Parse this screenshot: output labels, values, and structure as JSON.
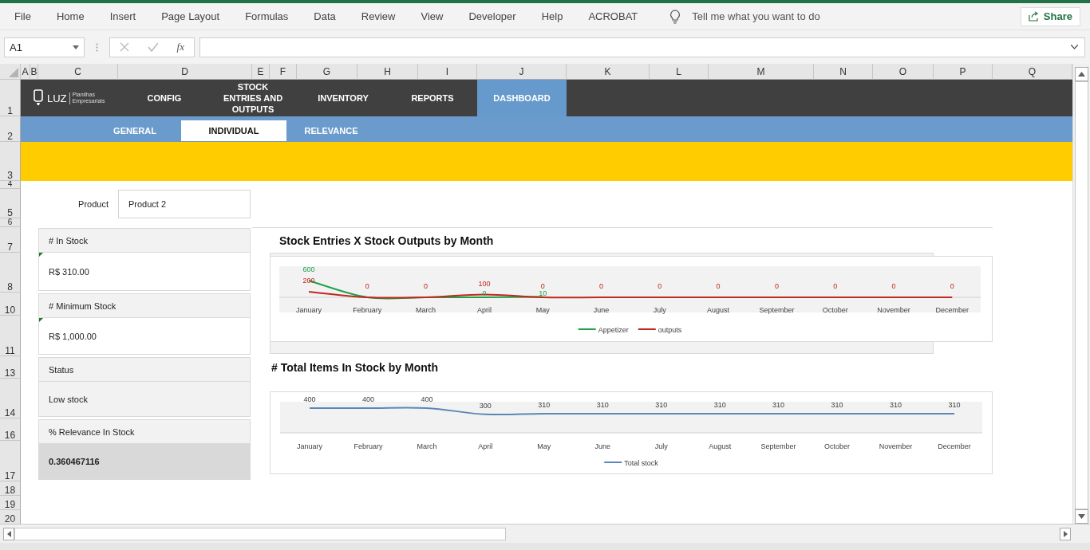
{
  "ribbon": {
    "tabs": [
      "File",
      "Home",
      "Insert",
      "Page Layout",
      "Formulas",
      "Data",
      "Review",
      "View",
      "Developer",
      "Help",
      "ACROBAT"
    ],
    "tell_me": {
      "placeholder": "Tell me what you want to do"
    },
    "share": "Share"
  },
  "formula_bar": {
    "name_box": "A1",
    "function_label": "fx"
  },
  "sheet": {
    "columns": [
      "A",
      "B",
      "C",
      "D",
      "E",
      "F",
      "G",
      "H",
      "I",
      "J",
      "K",
      "L",
      "M",
      "N",
      "O",
      "P",
      "Q"
    ],
    "rows": [
      "1",
      "2",
      "3",
      "4",
      "5",
      "6",
      "7",
      "8",
      "10",
      "11",
      "13",
      "14",
      "16",
      "17",
      "18",
      "19",
      "20"
    ]
  },
  "dashboard": {
    "logo": {
      "name": "LUZ",
      "tagline": "Planilhas Empresariais"
    },
    "nav": [
      {
        "label": "CONFIG",
        "selected": false
      },
      {
        "label": "STOCK ENTRIES AND OUTPUTS",
        "selected": false
      },
      {
        "label": "INVENTORY",
        "selected": false
      },
      {
        "label": "REPORTS",
        "selected": false
      },
      {
        "label": "DASHBOARD",
        "selected": true
      }
    ],
    "subnav": [
      {
        "label": "GENERAL",
        "selected": false
      },
      {
        "label": "INDIVIDUAL",
        "selected": true
      },
      {
        "label": "RELEVANCE",
        "selected": false
      }
    ],
    "product": {
      "label": "Product",
      "value": "Product 2"
    },
    "cards": [
      {
        "title": "# In Stock",
        "value": "R$ 310.00",
        "kind": "plain",
        "error_mark": true
      },
      {
        "title": "# Minimum Stock",
        "value": "R$ 1,000.00",
        "kind": "plain",
        "error_mark": true
      },
      {
        "title": "Status",
        "value": "Low stock",
        "kind": "shaded",
        "error_mark": false
      },
      {
        "title": "% Relevance In Stock",
        "value": "0.360467116",
        "kind": "highlight",
        "error_mark": false
      }
    ],
    "charts": [
      {
        "chart_data": {
          "type": "line",
          "title": "Stock Entries X Stock Outputs by Month",
          "categories": [
            "January",
            "February",
            "March",
            "April",
            "May",
            "June",
            "July",
            "August",
            "September",
            "October",
            "November",
            "December"
          ],
          "series": [
            {
              "name": "Appetizer",
              "color": "#1fa24a",
              "values": [
                600,
                0,
                0,
                0,
                10,
                null,
                null,
                null,
                null,
                null,
                null,
                null
              ],
              "value_labels": [
                "600",
                null,
                null,
                "0",
                "10",
                null,
                null,
                null,
                null,
                null,
                null,
                null
              ]
            },
            {
              "name": "outputs",
              "color": "#c0281c",
              "values": [
                200,
                0,
                0,
                100,
                0,
                0,
                0,
                0,
                0,
                0,
                0,
                0
              ],
              "value_labels": [
                "200",
                "0",
                "0",
                "100",
                "0",
                "0",
                "0",
                "0",
                "0",
                "0",
                "0",
                "0"
              ]
            }
          ],
          "legend": "bottom"
        }
      },
      {
        "chart_data": {
          "type": "line",
          "title": "# Total Items In Stock by Month",
          "categories": [
            "January",
            "February",
            "March",
            "April",
            "May",
            "June",
            "July",
            "August",
            "September",
            "October",
            "November",
            "December"
          ],
          "series": [
            {
              "name": "Total stock",
              "color": "#5b87b8",
              "values": [
                400,
                400,
                400,
                300,
                310,
                310,
                310,
                310,
                310,
                310,
                310,
                310
              ]
            }
          ],
          "data_labels": true,
          "legend": "bottom"
        }
      }
    ]
  }
}
